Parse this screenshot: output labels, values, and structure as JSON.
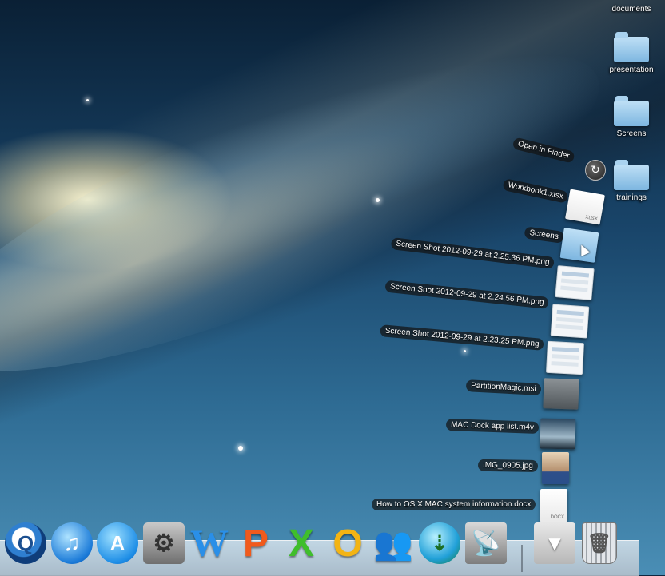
{
  "desktop": {
    "items": [
      {
        "label": "documents"
      },
      {
        "label": "presentation"
      },
      {
        "label": "Screens"
      },
      {
        "label": "trainings"
      }
    ]
  },
  "stack": {
    "open_in_finder": "Open in Finder",
    "items": [
      {
        "label": "Workbook1.xlsx",
        "thumb_tag": "XLSX"
      },
      {
        "label": "Screens"
      },
      {
        "label": "Screen Shot 2012-09-29 at 2.25.36 PM.png"
      },
      {
        "label": "Screen Shot 2012-09-29 at 2.24.56 PM.png"
      },
      {
        "label": "Screen Shot 2012-09-29 at 2.23.25 PM.png"
      },
      {
        "label": "PartitionMagic.msi"
      },
      {
        "label": "MAC Dock app list.m4v"
      },
      {
        "label": "IMG_0905.jpg"
      },
      {
        "label": "How to OS X MAC system information.docx",
        "thumb_tag": "DOCX"
      }
    ]
  },
  "dock": {
    "icons": [
      {
        "name": "quicktime-icon",
        "glyph": "Q"
      },
      {
        "name": "itunes-icon",
        "glyph": "♫"
      },
      {
        "name": "app-store-icon",
        "glyph": "A"
      },
      {
        "name": "system-preferences-icon",
        "glyph": "⚙"
      },
      {
        "name": "word-icon",
        "glyph": "W"
      },
      {
        "name": "powerpoint-icon",
        "glyph": "P"
      },
      {
        "name": "excel-icon",
        "glyph": "X"
      },
      {
        "name": "outlook-icon",
        "glyph": "O"
      },
      {
        "name": "messenger-icon",
        "glyph": "👥"
      },
      {
        "name": "network-globe-icon",
        "glyph": "⇣"
      },
      {
        "name": "remote-desktop-icon",
        "glyph": "📡"
      },
      {
        "name": "downloads-stack-icon",
        "glyph": "▼"
      },
      {
        "name": "trash-icon",
        "glyph": "🗑"
      }
    ]
  }
}
